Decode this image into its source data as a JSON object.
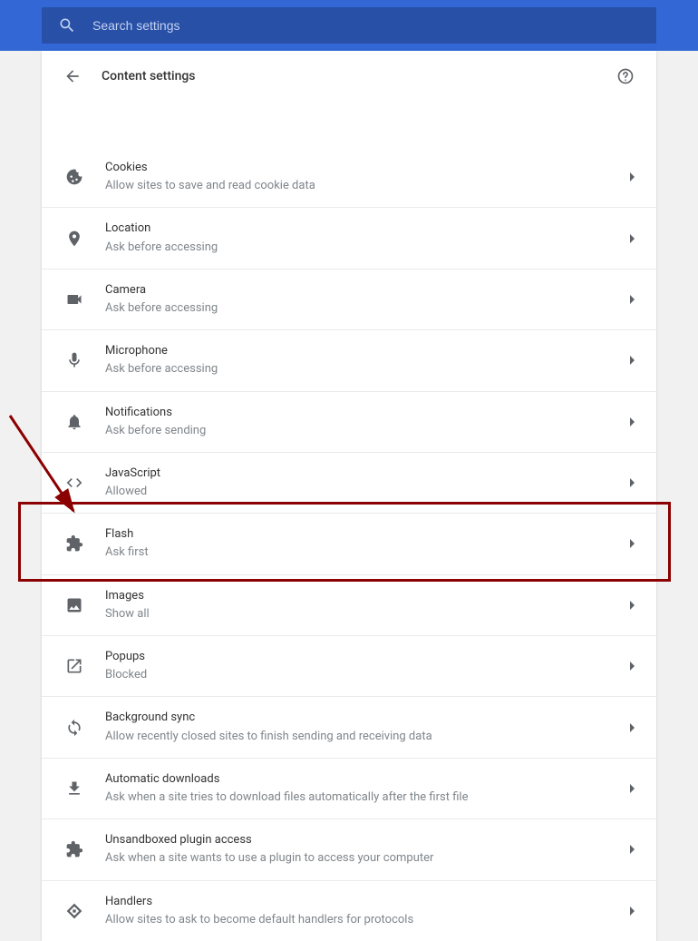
{
  "search": {
    "placeholder": "Search settings",
    "value": ""
  },
  "page": {
    "title": "Content settings"
  },
  "settings": [
    {
      "key": "cookies",
      "icon": "cookie-icon",
      "title": "Cookies",
      "subtitle": "Allow sites to save and read cookie data"
    },
    {
      "key": "location",
      "icon": "location-icon",
      "title": "Location",
      "subtitle": "Ask before accessing"
    },
    {
      "key": "camera",
      "icon": "camera-icon",
      "title": "Camera",
      "subtitle": "Ask before accessing"
    },
    {
      "key": "microphone",
      "icon": "microphone-icon",
      "title": "Microphone",
      "subtitle": "Ask before accessing"
    },
    {
      "key": "notifications",
      "icon": "bell-icon",
      "title": "Notifications",
      "subtitle": "Ask before sending"
    },
    {
      "key": "javascript",
      "icon": "code-icon",
      "title": "JavaScript",
      "subtitle": "Allowed"
    },
    {
      "key": "flash",
      "icon": "plugin-icon",
      "title": "Flash",
      "subtitle": "Ask first",
      "highlighted": true
    },
    {
      "key": "images",
      "icon": "image-icon",
      "title": "Images",
      "subtitle": "Show all"
    },
    {
      "key": "popups",
      "icon": "popup-icon",
      "title": "Popups",
      "subtitle": "Blocked"
    },
    {
      "key": "background-sync",
      "icon": "sync-icon",
      "title": "Background sync",
      "subtitle": "Allow recently closed sites to finish sending and receiving data"
    },
    {
      "key": "automatic-downloads",
      "icon": "download-icon",
      "title": "Automatic downloads",
      "subtitle": "Ask when a site tries to download files automatically after the first file"
    },
    {
      "key": "unsandboxed-plugin",
      "icon": "plugin-icon",
      "title": "Unsandboxed plugin access",
      "subtitle": "Ask when a site wants to use a plugin to access your computer"
    },
    {
      "key": "handlers",
      "icon": "handlers-icon",
      "title": "Handlers",
      "subtitle": "Allow sites to ask to become default handlers for protocols"
    }
  ],
  "annotation": {
    "highlight_key": "flash"
  }
}
